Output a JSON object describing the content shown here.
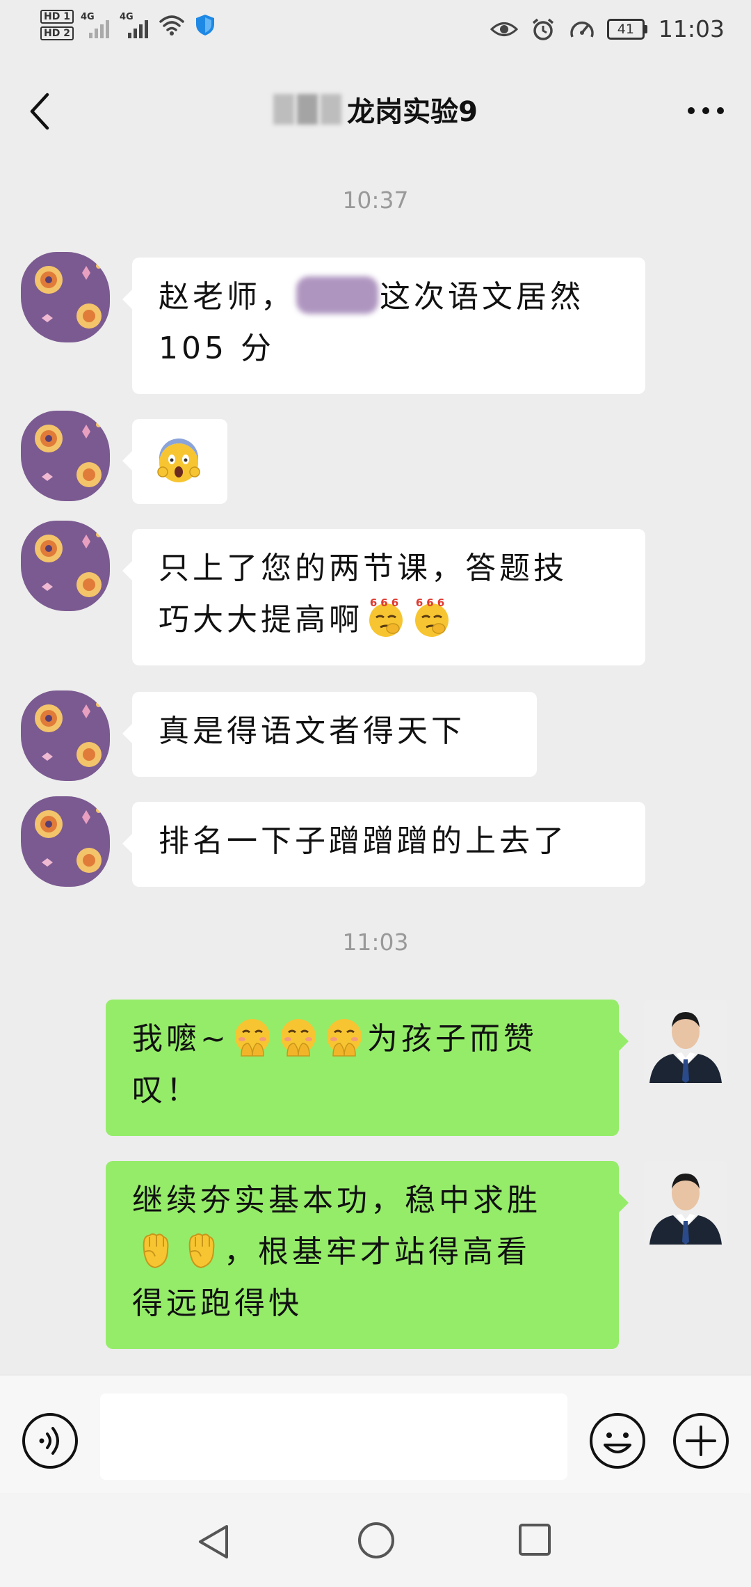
{
  "status_bar": {
    "hd_top": "HD 1",
    "hd_bottom": "HD 2",
    "signal_1_label": "4G",
    "signal_2_label": "4G",
    "battery": "41",
    "time": "11:03",
    "icons": [
      "hd-icon",
      "signal-icon",
      "wifi-icon",
      "shield-icon",
      "eye-icon",
      "alarm-icon",
      "speed-icon",
      "battery-icon"
    ]
  },
  "header": {
    "title": "龙岗实验9",
    "title_prefix_blurred": true
  },
  "chat": {
    "time_1": "10:37",
    "time_2": "11:03",
    "messages": [
      {
        "side": "in",
        "pre": "赵老师，",
        "blurred_name": true,
        "post": "这次语文居然",
        "line2": "105 分"
      },
      {
        "side": "in",
        "emoji": "scream-emoji"
      },
      {
        "side": "in",
        "line1": "只上了您的两节课，答题技",
        "line2": "巧大大提高啊",
        "emojis": [
          "666-emoji",
          "666-emoji"
        ],
        "emoji_text": "666"
      },
      {
        "side": "in",
        "text": "真是得语文者得天下"
      },
      {
        "side": "in",
        "text": "排名一下子蹭蹭蹭的上去了"
      },
      {
        "side": "out",
        "pre": "我嚒~",
        "emojis": [
          "blush-hands-emoji",
          "blush-hands-emoji",
          "blush-hands-emoji"
        ],
        "post": "为孩子而赞",
        "line2": "叹！"
      },
      {
        "side": "out",
        "line1": "继续夯实基本功，稳中求胜",
        "emojis": [
          "raised-fist-emoji",
          "raised-fist-emoji"
        ],
        "line2_post": "，根基牢才站得高看",
        "line3": "得远跑得快"
      }
    ]
  },
  "input_bar": {
    "placeholder": "",
    "value": ""
  },
  "colors": {
    "background": "#ededed",
    "incoming_bubble": "#ffffff",
    "outgoing_bubble": "#95ec69",
    "timestamp": "#999999"
  }
}
